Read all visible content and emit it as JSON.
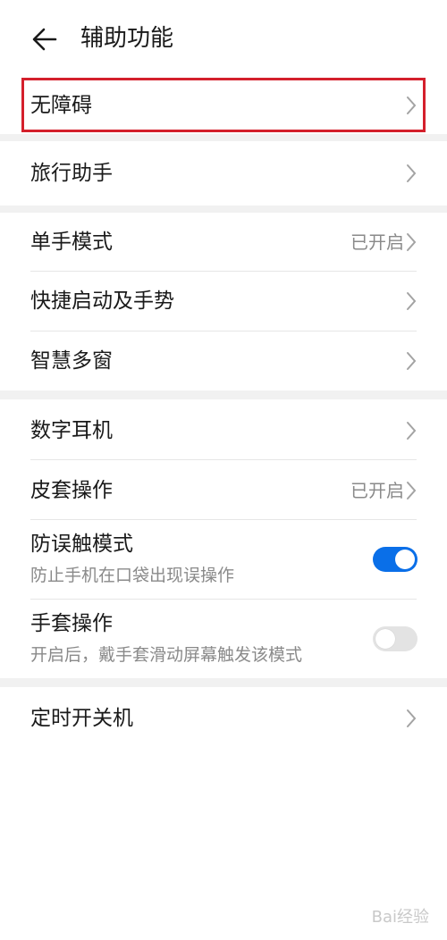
{
  "header": {
    "title": "辅助功能",
    "back_icon": "arrow-left-icon"
  },
  "groups": [
    {
      "items": [
        {
          "label": "无障碍",
          "highlighted": true
        }
      ]
    },
    {
      "items": [
        {
          "label": "旅行助手"
        }
      ]
    },
    {
      "items": [
        {
          "label": "单手模式",
          "value": "已开启"
        },
        {
          "label": "快捷启动及手势"
        },
        {
          "label": "智慧多窗"
        }
      ]
    },
    {
      "items": [
        {
          "label": "数字耳机"
        },
        {
          "label": "皮套操作",
          "value": "已开启"
        },
        {
          "label": "防误触模式",
          "subtitle": "防止手机在口袋出现误操作",
          "toggle": true
        },
        {
          "label": "手套操作",
          "subtitle": "开启后，戴手套滑动屏幕触发该模式",
          "toggle": false
        }
      ]
    },
    {
      "items": [
        {
          "label": "定时开关机"
        }
      ]
    }
  ],
  "colors": {
    "accent": "#0a6fe8",
    "highlight_border": "#d4202c",
    "section_gap": "#f1f1f1"
  },
  "watermark": "Bai经验"
}
